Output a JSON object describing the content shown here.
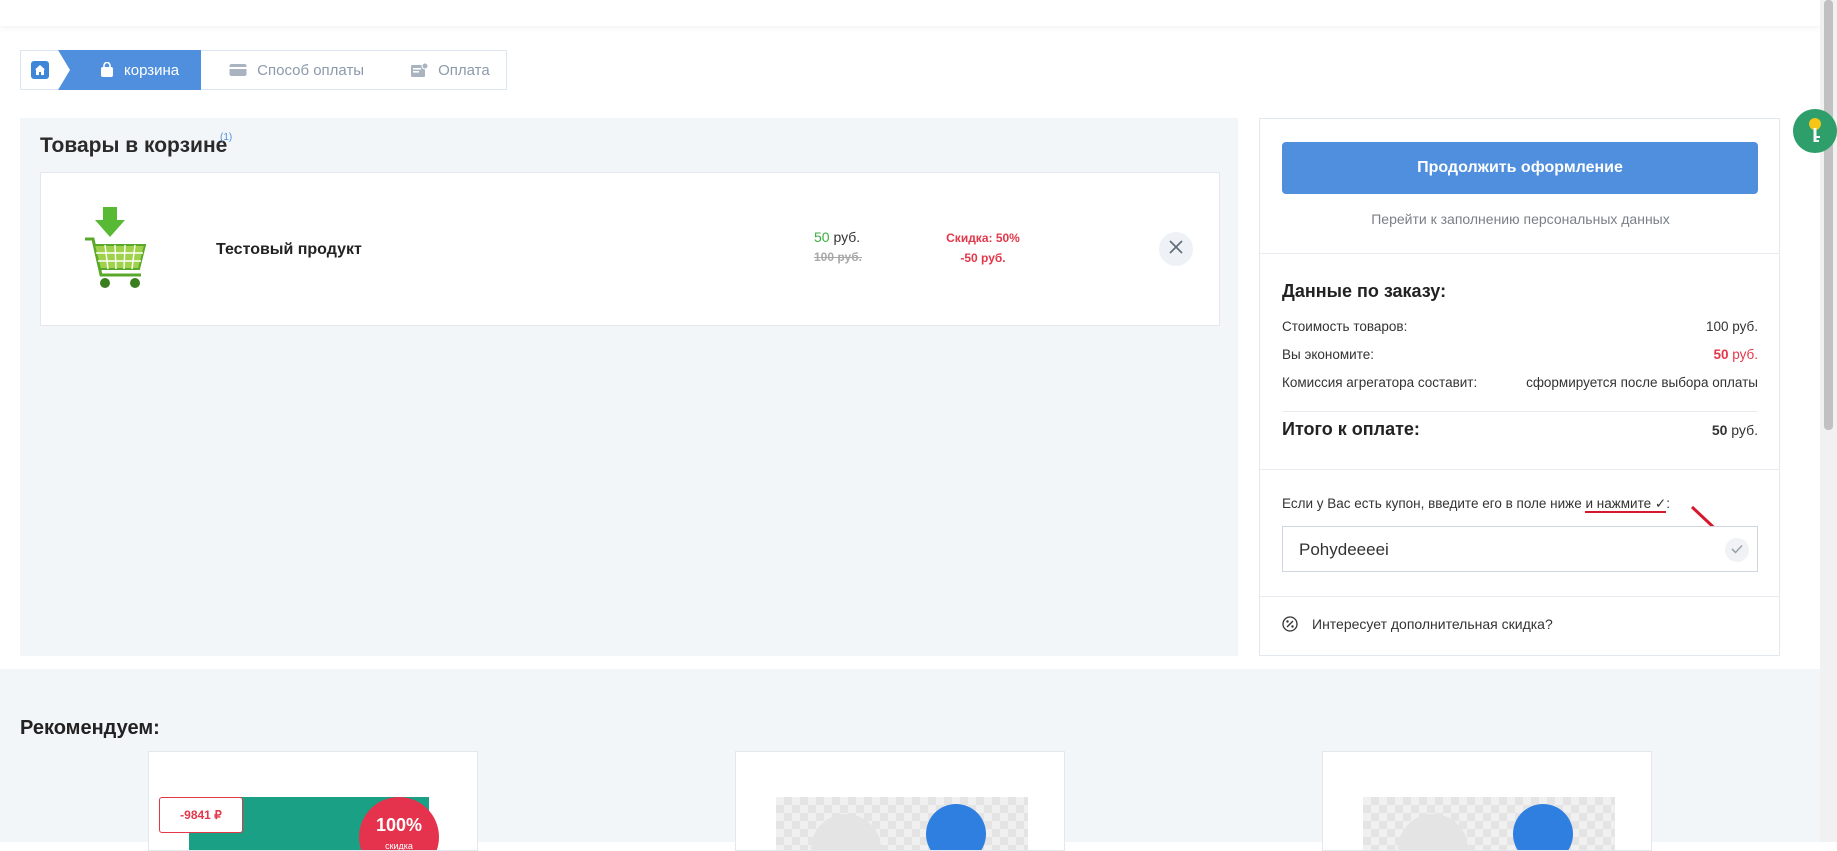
{
  "breadcrumb": {
    "home_icon": "home-icon",
    "steps": [
      {
        "label": "корзина",
        "icon": "bag-icon",
        "state": "active"
      },
      {
        "label": "Способ оплаты",
        "icon": "card-icon",
        "state": "inactive"
      },
      {
        "label": "Оплата",
        "icon": "receipt-icon",
        "state": "inactive"
      }
    ]
  },
  "cart": {
    "title": "Товары в корзине",
    "count": "(1)",
    "items": [
      {
        "name": "Тестовый продукт",
        "price_value": "50",
        "price_currency": "руб.",
        "old_price": "100 руб.",
        "discount_label": "Скидка: 50%",
        "discount_amount": "-50 руб.",
        "image_icon": "shopping-cart-icon"
      }
    ]
  },
  "order": {
    "continue_button": "Продолжить оформление",
    "continue_hint": "Перейти к заполнению персональных данных",
    "section_title": "Данные по заказу:",
    "rows": [
      {
        "label": "Стоимость товаров:",
        "value_num": "",
        "value": "100 руб."
      },
      {
        "label": "Вы экономите:",
        "value_num": "50",
        "value": "руб."
      },
      {
        "label": "Комиссия агрегатора составит:",
        "value_num": "",
        "value": "сформируется после выбора оплаты"
      }
    ],
    "total_label": "Итого к оплате:",
    "total_num": "50",
    "total_currency": "руб.",
    "coupon_text_before": "Если у Вас есть купон, введите его в поле ниже ",
    "coupon_text_underlined": "и нажмите ✓",
    "coupon_text_after": ":",
    "coupon_value": "Pohydeeeei",
    "extra_discount": "Интересует дополнительная скидка?"
  },
  "recommend": {
    "title": "Рекомендуем:",
    "cards": [
      {
        "badge": "-9841 ₽",
        "circle_big": "100%",
        "circle_small": "скидка"
      },
      {},
      {}
    ]
  },
  "colors": {
    "accent": "#4f8fde",
    "price_green": "#3cae3f",
    "discount_red": "#e3374a",
    "panel_bg": "#f3f6f9"
  }
}
